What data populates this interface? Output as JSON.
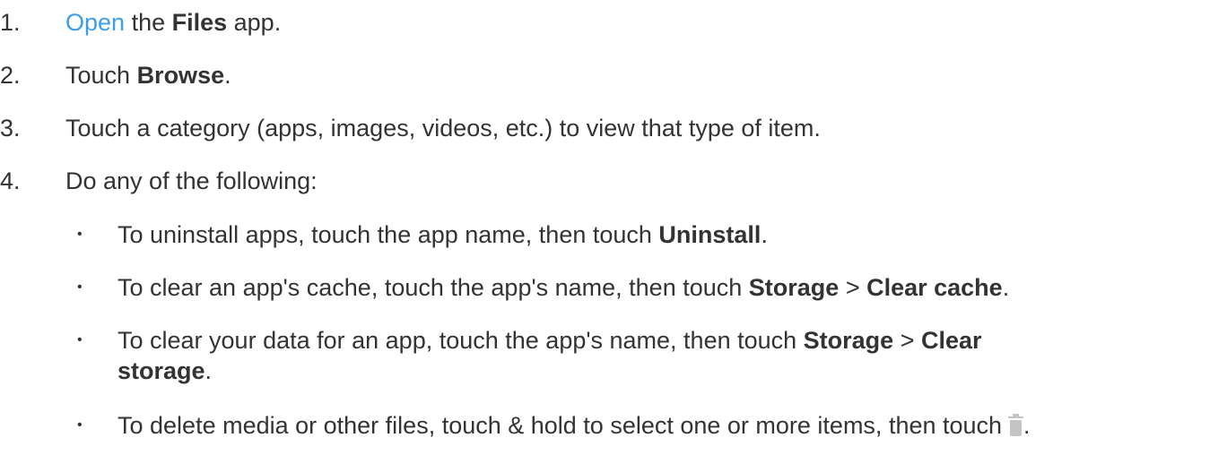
{
  "steps": [
    {
      "num": "1.",
      "link": "Open",
      "t1": " the ",
      "b1": "Files",
      "t2": " app."
    },
    {
      "num": "2.",
      "t1": "Touch ",
      "b1": "Browse",
      "t2": "."
    },
    {
      "num": "3.",
      "t1": "Touch a category (apps, images, videos, etc.) to view that type of item."
    },
    {
      "num": "4.",
      "t1": "Do any of the following:"
    }
  ],
  "bullets": [
    {
      "dot": "•",
      "t1": "To uninstall apps, touch the app name, then touch ",
      "b1": "Uninstall",
      "t2": "."
    },
    {
      "dot": "•",
      "t1": "To clear an app's cache, touch the app's name, then touch ",
      "b1": "Storage",
      "t2": " > ",
      "b2": "Clear cache",
      "t3": "."
    },
    {
      "dot": "•",
      "t1": "To clear your data for an app, touch the app's name, then touch ",
      "b1": "Storage",
      "t2": " > ",
      "b2": "Clear storage",
      "t3": "."
    },
    {
      "dot": "•",
      "t1": "To delete media or other files, touch & hold to select one or more items, then touch",
      "icon": "trash-icon",
      "t2": "."
    }
  ]
}
